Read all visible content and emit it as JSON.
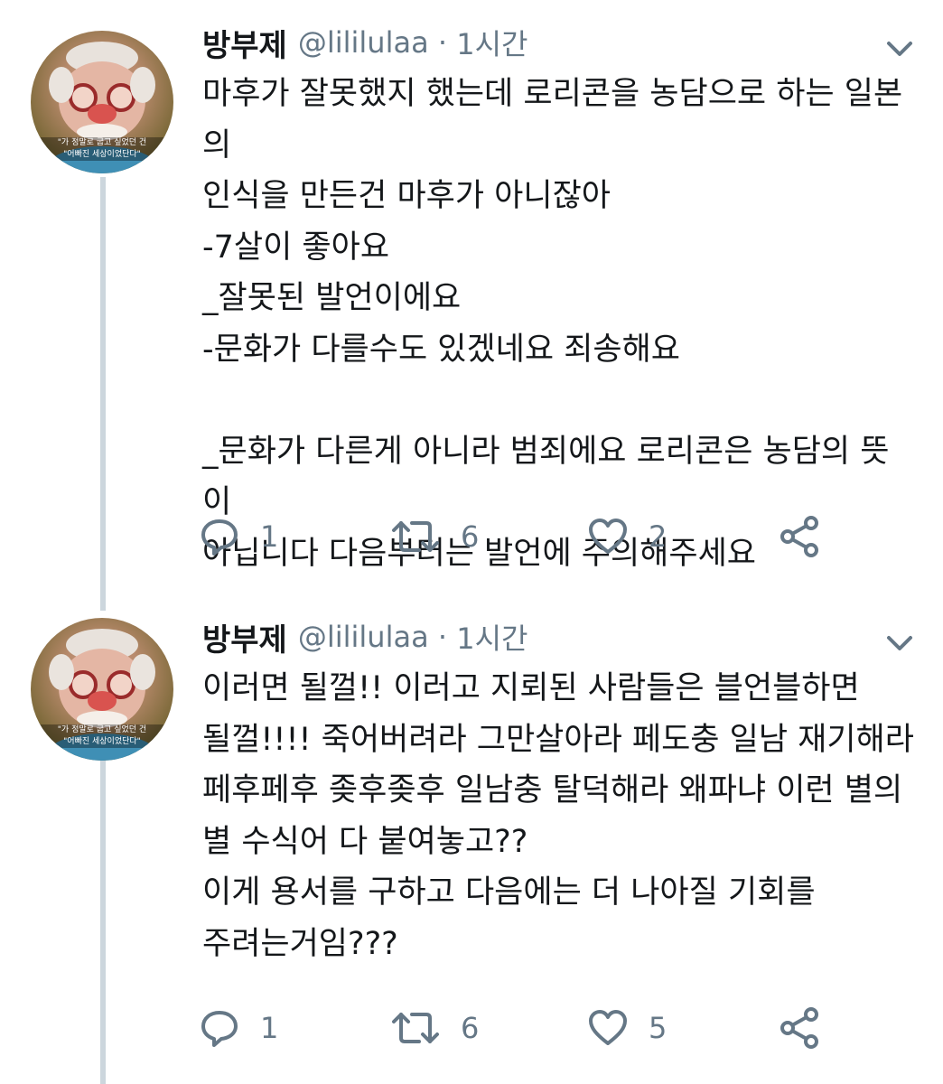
{
  "tweets": [
    {
      "author": {
        "display_name": "방부제",
        "handle": "@lililulaa",
        "time": "1시간",
        "avatar_caption": "\"가 정말로 굽고 싶었던 건\n\"어빠진 세상이었단다\""
      },
      "text": "마후가 잘못했지 했는데 로리콘을 농담으로 하는 일본의\n인식을 만든건 마후가 아니잖아\n-7살이 좋아요\n_잘못된 발언이에요\n-문화가 다를수도 있겠네요 죄송해요\n\n_문화가 다른게 아니라 범죄에요 로리콘은 농담의 뜻이\n아닙니다 다음부터는 발언에 주의해주세요",
      "counts": {
        "replies": "1",
        "retweets": "6",
        "likes": "2"
      }
    },
    {
      "author": {
        "display_name": "방부제",
        "handle": "@lililulaa",
        "time": "1시간",
        "avatar_caption": "\"가 정말로 굽고 싶었던 건\n\"어빠진 세상이었단다\""
      },
      "text": "이러면 될껄!! 이러고 지뢰된 사람들은 블언블하면\n될껄!!!! 죽어버려라 그만살아라 페도충 일남 재기해라\n페후페후 좆후좆후 일남충 탈덕해라 왜파냐 이런 별의\n별 수식어 다 붙여놓고??\n이게 용서를 구하고 다음에는 더 나아질 기회를\n주려는거임???",
      "counts": {
        "replies": "1",
        "retweets": "6",
        "likes": "5"
      }
    }
  ],
  "icons": {
    "reply": "reply-icon",
    "retweet": "retweet-icon",
    "like": "heart-icon",
    "share": "share-icon",
    "menu": "chevron-down-icon"
  },
  "colors": {
    "text": "#14171a",
    "meta": "#657786",
    "icon": "#657786",
    "thread_line": "#ccd6dd"
  }
}
